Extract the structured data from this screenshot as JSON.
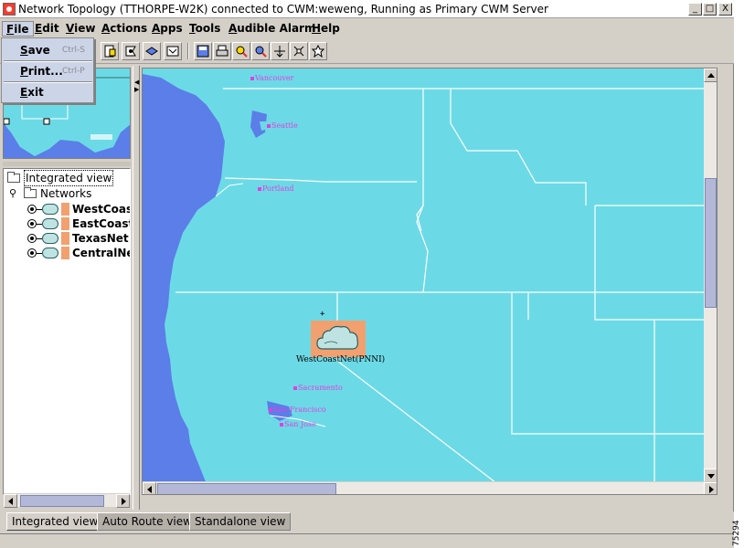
{
  "window": {
    "title": "Network Topology  (TTHORPE-W2K) connected to CWM:weweng, Running as Primary CWM Server",
    "controls": {
      "minimize": "_",
      "maximize": "□",
      "close": "X"
    }
  },
  "menubar": {
    "items": [
      {
        "ul": "F",
        "rest": "ile"
      },
      {
        "ul": "E",
        "rest": "dit"
      },
      {
        "ul": "V",
        "rest": "iew"
      },
      {
        "ul": "A",
        "rest": "ctions"
      },
      {
        "ul": "A",
        "rest": "pps"
      },
      {
        "ul": "T",
        "rest": "ools"
      },
      {
        "ul": "A",
        "rest": "udible Alarm"
      },
      {
        "ul": "H",
        "rest": "elp"
      }
    ]
  },
  "file_menu": {
    "items": [
      {
        "ul": "S",
        "rest": "ave",
        "shortcut": "Ctrl-S"
      },
      {
        "ul": "P",
        "rest": "rint...",
        "shortcut": "Ctrl-P"
      },
      {
        "ul": "E",
        "rest": "xit",
        "shortcut": ""
      }
    ]
  },
  "toolbar": {
    "icons": [
      "document-icon",
      "flag-icon",
      "layers-icon",
      "map-layer-icon",
      "save-icon",
      "print-icon",
      "zoom-in-icon",
      "zoom-out-icon",
      "fit-icon",
      "pan-icon",
      "select-icon"
    ]
  },
  "tree": {
    "root": "Integrated view",
    "networks": "Networks",
    "items": [
      "WestCoast",
      "EastCoastN",
      "TexasNet",
      "CentralNet"
    ]
  },
  "map": {
    "cities": [
      "Vancouver",
      "Seattle",
      "Portland",
      "Sacramento",
      "San Francisco",
      "San Jose"
    ],
    "network_label": "WestCoastNet(PNNI)",
    "colors": {
      "water": "#5b7ee8",
      "land": "#6cdae6",
      "border": "#ffffff",
      "city": "#e040e0",
      "node": "#f2a070"
    }
  },
  "tabs": [
    "Integrated view",
    "Auto Route view",
    "Standalone view"
  ],
  "figure_id": "75294"
}
